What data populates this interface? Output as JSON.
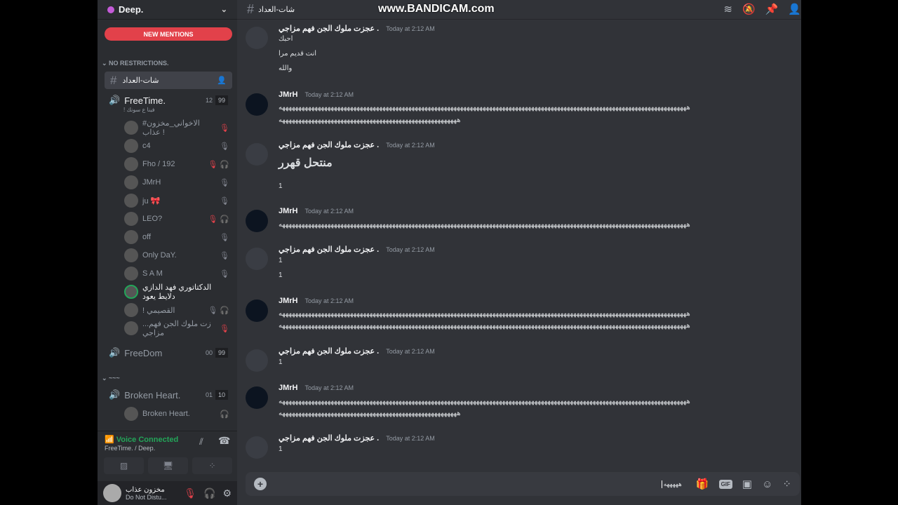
{
  "server": {
    "name": "Deep.",
    "new_mentions": "NEW MENTIONS",
    "category": "NO RESTRICTIONS.",
    "category2": "~~~"
  },
  "channel": {
    "name": "شات-العداد"
  },
  "voice_channels": [
    {
      "name": "FreeTime.",
      "count": "12",
      "limit": "99",
      "status": "! فينا ع سونك"
    },
    {
      "name": "FreeDom",
      "count": "00",
      "limit": "99"
    },
    {
      "name": "Broken Heart.",
      "count": "01",
      "limit": "10"
    }
  ],
  "members": [
    {
      "name": "#الاخواني_مخزون عذاب !",
      "icons": [
        "mic-muted-red"
      ]
    },
    {
      "name": "c4",
      "icons": [
        "mic-muted"
      ]
    },
    {
      "name": "Fho / 192",
      "icons": [
        "mic-muted-red",
        "headphones-deafened"
      ]
    },
    {
      "name": "JMrH",
      "icons": [
        "mic-muted"
      ]
    },
    {
      "name": "ju 🎀",
      "icons": [
        "mic-muted"
      ]
    },
    {
      "name": "LEO?",
      "icons": [
        "mic-muted-red",
        "headphones-deafened"
      ]
    },
    {
      "name": "off",
      "icons": [
        "mic"
      ]
    },
    {
      "name": "Only DaY.",
      "icons": [
        "mic-muted"
      ]
    },
    {
      "name": "S A M",
      "icons": [
        "mic-muted"
      ]
    },
    {
      "name": "الدكتاتوري فهد الدازي دلايط يعود",
      "icons": []
    },
    {
      "name": "! القصيمي",
      "icons": [
        "mic-muted",
        "headphones-deafened"
      ]
    },
    {
      "name": "...زت ملوك الجن فهم مزاجي",
      "icons": [
        "mic-muted-red"
      ]
    }
  ],
  "broken_member": {
    "name": "Broken Heart.",
    "icons": [
      "headphones-deafened"
    ]
  },
  "voice_panel": {
    "status": "Voice Connected",
    "location": "FreeTime. / Deep."
  },
  "user": {
    "name": "مخزون عذاب",
    "status": "Do Not Distu..."
  },
  "watermark": "www.BANDICAM.com",
  "messages": [
    {
      "author": "عجزت ملوك الجن فهم مزاجي .",
      "time": "Today at 2:12 AM",
      "lines": [
        "احبك",
        "انت قديم مرا",
        "والله"
      ]
    },
    {
      "author": "JMrH",
      "time": "Today at 2:12 AM",
      "lines": [
        "ههههههههههههههههههههههههههههههههههههههههههههههههههههههههههههههههههههههههههههههههههههههههههههههههههههههههههههههههههههههههههههههه",
        "هههههههههههههههههههههههههههههههههههههههههههههههههههههههه"
      ]
    },
    {
      "author": "عجزت ملوك الجن فهم مزاجي .",
      "time": "Today at 2:12 AM",
      "lines": [
        "منتحل قهرر",
        "1"
      ],
      "big": 0
    },
    {
      "author": "JMrH",
      "time": "Today at 2:12 AM",
      "lines": [
        "ههههههههههههههههههههههههههههههههههههههههههههههههههههههههههههههههههههههههههههههههههههههههههههههههههههههههههههههههههههههههههههههه"
      ]
    },
    {
      "author": "عجزت ملوك الجن فهم مزاجي .",
      "time": "Today at 2:12 AM",
      "lines": [
        "1",
        "1"
      ]
    },
    {
      "author": "JMrH",
      "time": "Today at 2:12 AM",
      "lines": [
        "ههههههههههههههههههههههههههههههههههههههههههههههههههههههههههههههههههههههههههههههههههههههههههههههههههههههههههههههههههههههههههههههه",
        "ههههههههههههههههههههههههههههههههههههههههههههههههههههههههههههههههههههههههههههههههههههههههههههههههههههههههههههههههههههههههههههههه"
      ]
    },
    {
      "author": "عجزت ملوك الجن فهم مزاجي .",
      "time": "Today at 2:12 AM",
      "lines": [
        "1"
      ]
    },
    {
      "author": "JMrH",
      "time": "Today at 2:12 AM",
      "lines": [
        "ههههههههههههههههههههههههههههههههههههههههههههههههههههههههههههههههههههههههههههههههههههههههههههههههههههههههههههههههههههههههههههههه",
        "هههههههههههههههههههههههههههههههههههههههههههههههههههههههه"
      ]
    },
    {
      "author": "عجزت ملوك الجن فهم مزاجي .",
      "time": "Today at 2:12 AM",
      "lines": [
        "1"
      ]
    }
  ],
  "composer": {
    "value": "هههههه"
  }
}
